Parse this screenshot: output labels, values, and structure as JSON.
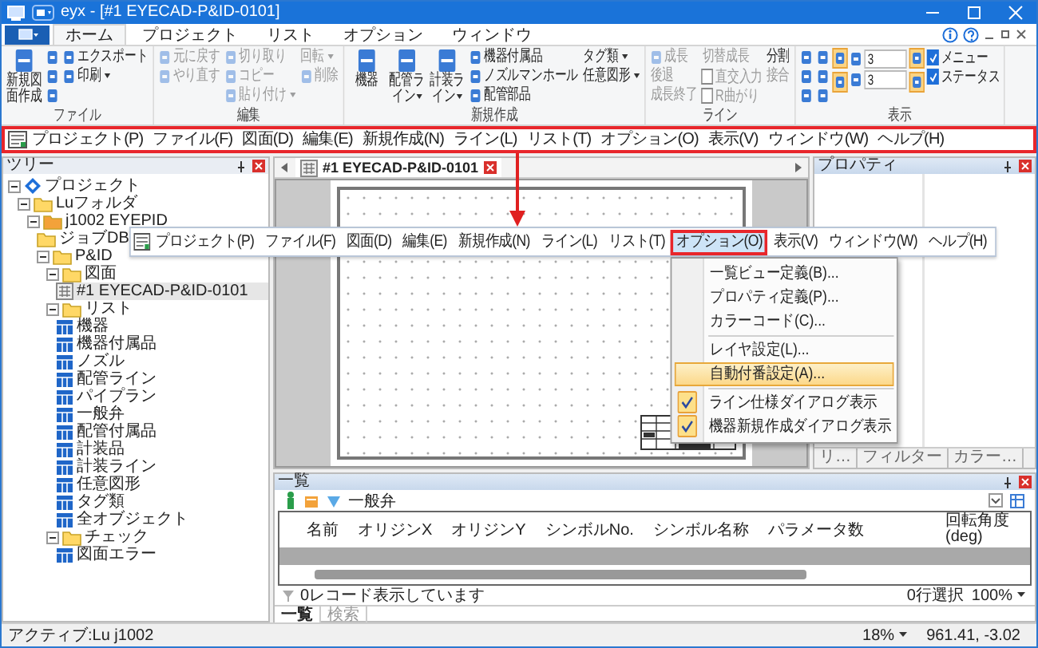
{
  "window": {
    "title": "eyx - [#1 EYECAD-P&ID-0101]"
  },
  "ribbon": {
    "tabs": [
      {
        "label": "ホーム",
        "selected": true
      },
      {
        "label": "プロジェクト",
        "selected": false
      },
      {
        "label": "リスト",
        "selected": false
      },
      {
        "label": "オプション",
        "selected": false
      },
      {
        "label": "ウィンドウ",
        "selected": false
      }
    ],
    "groups": [
      {
        "label": "ファイル",
        "columns": [
          [
            {
              "kind": "large",
              "label": "新規図面作成"
            }
          ],
          [
            {
              "kind": "icon"
            },
            {
              "kind": "icon"
            },
            {
              "kind": "icon"
            }
          ],
          [
            {
              "kind": "small",
              "label": "エクスポート"
            },
            {
              "kind": "small",
              "label": "印刷",
              "dropdown": true
            }
          ]
        ]
      },
      {
        "label": "編集",
        "columns": [
          [
            {
              "kind": "small",
              "label": "元に戻す",
              "disabled": true
            },
            {
              "kind": "small",
              "label": "やり直す",
              "disabled": true
            }
          ],
          [
            {
              "kind": "small",
              "label": "切り取り",
              "disabled": true
            },
            {
              "kind": "small",
              "label": "コピー",
              "disabled": true
            },
            {
              "kind": "small",
              "label": "貼り付け",
              "disabled": true,
              "dropdown": true
            }
          ],
          [
            {
              "kind": "text",
              "label": "回転",
              "disabled": true,
              "dropdown": true
            },
            {
              "kind": "small",
              "label": "削除",
              "disabled": true
            }
          ]
        ]
      },
      {
        "label": "新規作成",
        "columns": [
          [
            {
              "kind": "large",
              "label": "機器"
            }
          ],
          [
            {
              "kind": "large",
              "label": "配管ライン",
              "dropdown": true
            }
          ],
          [
            {
              "kind": "large",
              "label": "計装ライン",
              "dropdown": true
            }
          ],
          [
            {
              "kind": "small",
              "label": "機器付属品"
            },
            {
              "kind": "small",
              "label": "ノズルマンホール"
            },
            {
              "kind": "small",
              "label": "配管部品"
            }
          ],
          [
            {
              "kind": "text",
              "label": "タグ類",
              "dropdown": true
            },
            {
              "kind": "text",
              "label": "任意図形",
              "dropdown": true
            }
          ]
        ]
      },
      {
        "label": "ライン",
        "columns": [
          [
            {
              "kind": "small",
              "label": "成長",
              "disabled": true
            },
            {
              "kind": "text",
              "label": "後退",
              "disabled": true
            },
            {
              "kind": "text",
              "label": "成長終了",
              "disabled": true
            }
          ],
          [
            {
              "kind": "text",
              "label": "切替成長",
              "disabled": true
            },
            {
              "kind": "check",
              "label": "直交入力",
              "checked": false,
              "disabled": true
            },
            {
              "kind": "check",
              "label": "R曲がり",
              "checked": false,
              "disabled": true
            }
          ],
          [
            {
              "kind": "text",
              "label": "分割",
              "disabled": false
            },
            {
              "kind": "text",
              "label": "接合",
              "disabled": true
            }
          ]
        ]
      },
      {
        "label": "表示",
        "columns": [
          [
            {
              "kind": "icon"
            },
            {
              "kind": "icon"
            },
            {
              "kind": "icon"
            }
          ],
          [
            {
              "kind": "icon"
            },
            {
              "kind": "icon"
            },
            {
              "kind": "icon"
            }
          ],
          [
            {
              "kind": "toggle",
              "selected": true
            },
            {
              "kind": "toggle",
              "selected": true
            }
          ],
          [
            {
              "kind": "spin",
              "value": "3"
            },
            {
              "kind": "spin",
              "value": "3"
            }
          ],
          [
            {
              "kind": "toggle",
              "selected": true
            },
            {
              "kind": "toggle",
              "selected": true
            }
          ],
          [
            {
              "kind": "check",
              "label": "メニュー",
              "checked": true
            },
            {
              "kind": "check",
              "label": "ステータス",
              "checked": true
            }
          ]
        ]
      }
    ]
  },
  "menubar": [
    "プロジェクト(P)",
    "ファイル(F)",
    "図面(D)",
    "編集(E)",
    "新規作成(N)",
    "ライン(L)",
    "リスト(T)",
    "オプション(O)",
    "表示(V)",
    "ウィンドウ(W)",
    "ヘルプ(H)"
  ],
  "tree": {
    "title": "ツリー",
    "items": [
      {
        "label": "プロジェクト",
        "kind": "project",
        "expanded": true,
        "selected": false,
        "children": [
          {
            "label": "Luフォルダ",
            "kind": "folder",
            "expanded": true,
            "selected": false,
            "children": [
              {
                "label": "j1002 EYEPID",
                "kind": "job",
                "expanded": true,
                "selected": false,
                "children": [
                  {
                    "label": "ジョブDB",
                    "kind": "folder",
                    "selected": false
                  },
                  {
                    "label": "P&ID",
                    "kind": "folder",
                    "expanded": true,
                    "selected": false,
                    "children": [
                      {
                        "label": "図面",
                        "kind": "folder",
                        "expanded": true,
                        "selected": false,
                        "children": [
                          {
                            "label": "#1 EYECAD-P&ID-0101",
                            "kind": "drawing",
                            "selected": true
                          }
                        ]
                      },
                      {
                        "label": "リスト",
                        "kind": "folder",
                        "expanded": true,
                        "selected": false,
                        "children": [
                          {
                            "label": "機器",
                            "kind": "list",
                            "selected": false
                          },
                          {
                            "label": "機器付属品",
                            "kind": "list",
                            "selected": false
                          },
                          {
                            "label": "ノズル",
                            "kind": "list",
                            "selected": false
                          },
                          {
                            "label": "配管ライン",
                            "kind": "list",
                            "selected": false
                          },
                          {
                            "label": "パイプラン",
                            "kind": "list",
                            "selected": false
                          },
                          {
                            "label": "一般弁",
                            "kind": "list",
                            "selected": false
                          },
                          {
                            "label": "配管付属品",
                            "kind": "list",
                            "selected": false
                          },
                          {
                            "label": "計装品",
                            "kind": "list",
                            "selected": false
                          },
                          {
                            "label": "計装ライン",
                            "kind": "list",
                            "selected": false
                          },
                          {
                            "label": "任意図形",
                            "kind": "list",
                            "selected": false
                          },
                          {
                            "label": "タグ類",
                            "kind": "list",
                            "selected": false
                          },
                          {
                            "label": "全オブジェクト",
                            "kind": "list",
                            "selected": false
                          }
                        ]
                      },
                      {
                        "label": "チェック",
                        "kind": "folder",
                        "expanded": true,
                        "selected": false,
                        "children": [
                          {
                            "label": "図面エラー",
                            "kind": "list",
                            "selected": false
                          }
                        ]
                      }
                    ]
                  }
                ]
              }
            ]
          }
        ]
      }
    ]
  },
  "document_tabs": [
    {
      "label": "#1 EYECAD-P&ID-0101",
      "selected": true
    }
  ],
  "properties": {
    "title": "プロパティ",
    "tabs": [
      "リ…",
      "フィルター",
      "カラー…"
    ]
  },
  "list_panel": {
    "title": "一覧",
    "filter": "一般弁",
    "columns": [
      "名前",
      "オリジンX",
      "オリジンY",
      "シンボルNo.",
      "シンボル名称",
      "パラメータ数",
      "回転角度 (deg)"
    ],
    "status": "0レコード表示しています",
    "selection": "0行選択",
    "zoom": "100%",
    "tabs": [
      {
        "label": "一覧",
        "selected": true
      },
      {
        "label": "検索",
        "selected": false
      }
    ]
  },
  "menubar_zoomed": [
    {
      "label": "プロジェクト(P)",
      "selected": false
    },
    {
      "label": "ファイル(F)",
      "selected": false
    },
    {
      "label": "図面(D)",
      "selected": false
    },
    {
      "label": "編集(E)",
      "selected": false
    },
    {
      "label": "新規作成(N)",
      "selected": false
    },
    {
      "label": "ライン(L)",
      "selected": false
    },
    {
      "label": "リスト(T)",
      "selected": false
    },
    {
      "label": "オプション(O)",
      "selected": true
    },
    {
      "label": "表示(V)",
      "selected": false
    },
    {
      "label": "ウィンドウ(W)",
      "selected": false
    },
    {
      "label": "ヘルプ(H)",
      "selected": false
    }
  ],
  "dropdown": [
    {
      "kind": "command",
      "label": "一覧ビュー定義(B)...",
      "selected": false
    },
    {
      "kind": "command",
      "label": "プロパティ定義(P)...",
      "selected": false
    },
    {
      "kind": "command",
      "label": "カラーコード(C)...",
      "selected": false
    },
    {
      "kind": "separator"
    },
    {
      "kind": "command",
      "label": "レイヤ設定(L)...",
      "selected": false
    },
    {
      "kind": "command",
      "label": "自動付番設定(A)...",
      "selected": true
    },
    {
      "kind": "separator"
    },
    {
      "kind": "check",
      "label": "ライン仕様ダイアログ表示",
      "checked": true
    },
    {
      "kind": "check",
      "label": "機器新規作成ダイアログ表示",
      "checked": true
    }
  ],
  "status_bar": {
    "active": "アクティブ:Lu j1002",
    "zoom": "18%",
    "coords": "961.41, -3.02"
  }
}
